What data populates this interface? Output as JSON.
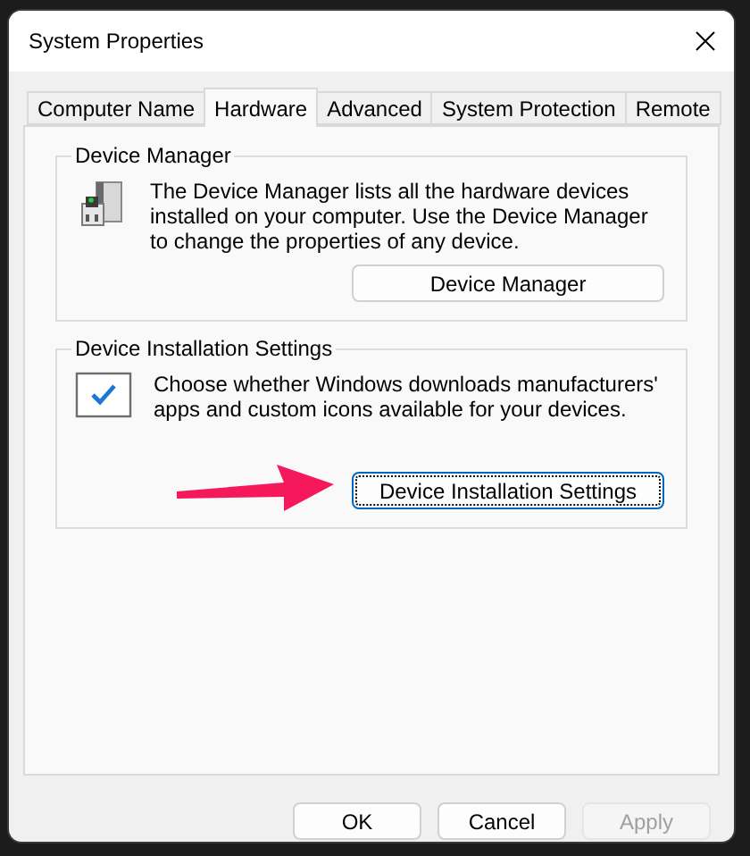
{
  "window": {
    "title": "System Properties"
  },
  "tabs": [
    {
      "label": "Computer Name",
      "selected": false
    },
    {
      "label": "Hardware",
      "selected": true
    },
    {
      "label": "Advanced",
      "selected": false
    },
    {
      "label": "System Protection",
      "selected": false
    },
    {
      "label": "Remote",
      "selected": false
    }
  ],
  "groups": [
    {
      "kind": "device-manager",
      "title": "Device Manager",
      "description": "The Device Manager lists all the hardware devices installed on your computer. Use the Device Manager to change the properties of any device.",
      "button": {
        "label": "Device Manager",
        "focused": false
      }
    },
    {
      "kind": "installation",
      "title": "Device Installation Settings",
      "description": "Choose whether Windows downloads manufacturers' apps and custom icons available for your devices.",
      "button": {
        "label": "Device Installation Settings",
        "focused": true
      }
    }
  ],
  "buttons": [
    {
      "label": "OK",
      "disabled": false
    },
    {
      "label": "Cancel",
      "disabled": false
    },
    {
      "label": "Apply",
      "disabled": true
    }
  ]
}
